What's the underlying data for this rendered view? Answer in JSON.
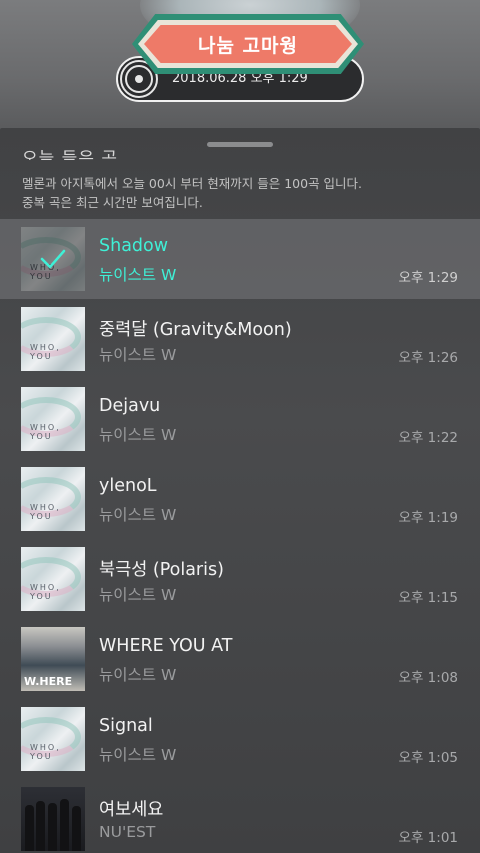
{
  "header": {
    "title": "나눔 고마웡",
    "datetime": "2018.06.28 오후 1:29"
  },
  "sheet": {
    "cut_title": "오늘 들은 곡",
    "description_line1": "멜론과 아지톡에서 오늘 00시 부터 현재까지 들은 100곡 입니다.",
    "description_line2": "중복 곡은 최근 시간만 보여집니다."
  },
  "songs": [
    {
      "title": "Shadow",
      "artist": "뉴이스트 W",
      "time": "오후 1:29",
      "album": "WHO, YOU"
    },
    {
      "title": "중력달 (Gravity&Moon)",
      "artist": "뉴이스트 W",
      "time": "오후 1:26",
      "album": "WHO, YOU"
    },
    {
      "title": "Dejavu",
      "artist": "뉴이스트 W",
      "time": "오후 1:22",
      "album": "WHO, YOU"
    },
    {
      "title": "ylenoL",
      "artist": "뉴이스트 W",
      "time": "오후 1:19",
      "album": "WHO, YOU"
    },
    {
      "title": "북극성 (Polaris)",
      "artist": "뉴이스트 W",
      "time": "오후 1:15",
      "album": "WHO, YOU"
    },
    {
      "title": "WHERE YOU AT",
      "artist": "뉴이스트 W",
      "time": "오후 1:08",
      "album": "W.HERE"
    },
    {
      "title": "Signal",
      "artist": "뉴이스트 W",
      "time": "오후 1:05",
      "album": "WHO, YOU"
    },
    {
      "title": "여보세요",
      "artist": "NU'EST",
      "time": "오후 1:01",
      "album": ""
    }
  ],
  "colors": {
    "accent": "#3ff0d6",
    "banner": "#ee7a68",
    "banner_border": "#2f8f76"
  },
  "icons": {
    "disc": "disc-icon",
    "check": "check-icon"
  }
}
